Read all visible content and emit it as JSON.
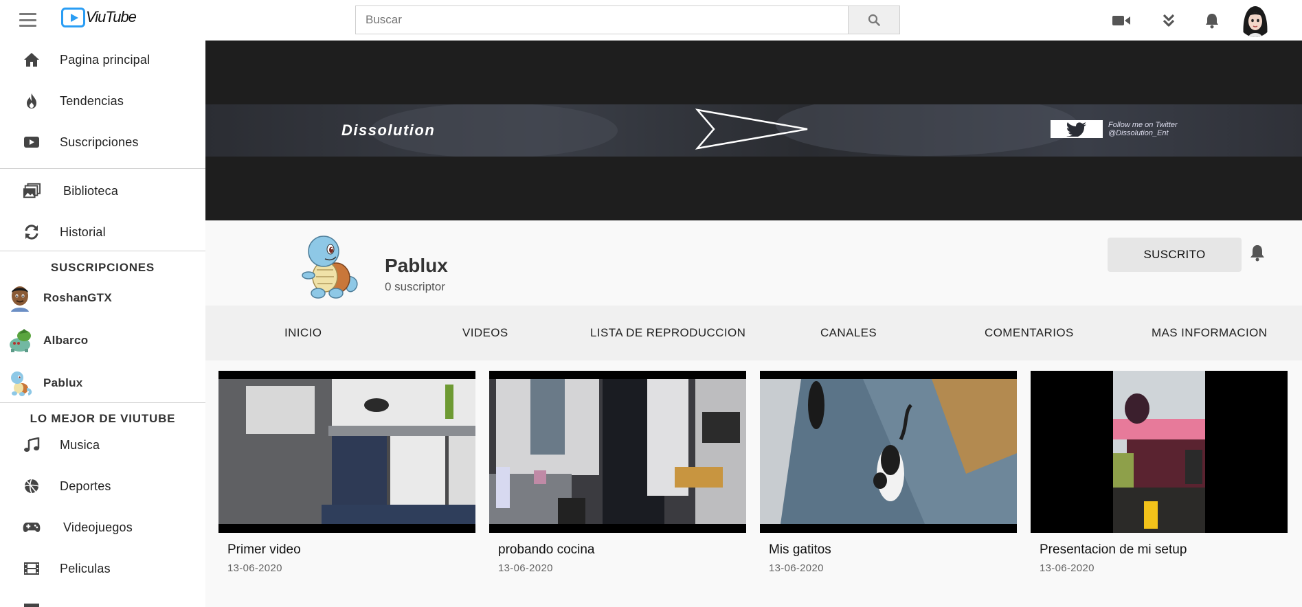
{
  "app": {
    "logo_text": "ViuTube",
    "brand_color": "#2a9df4"
  },
  "search": {
    "placeholder": "Buscar",
    "value": ""
  },
  "topbar_icons": [
    "video-camera-icon",
    "double-chevron-down-icon",
    "bell-icon",
    "user-avatar"
  ],
  "sidebar": {
    "main_items": [
      {
        "label": "Pagina principal",
        "icon": "home-icon"
      },
      {
        "label": "Tendencias",
        "icon": "fire-icon"
      },
      {
        "label": "Suscripciones",
        "icon": "subscriptions-icon"
      }
    ],
    "library_items": [
      {
        "label": "Biblioteca",
        "icon": "library-icon"
      },
      {
        "label": "Historial",
        "icon": "history-icon"
      }
    ],
    "subscriptions_heading": "SUSCRIPCIONES",
    "subscriptions": [
      {
        "label": "RoshanGTX"
      },
      {
        "label": "Albarco"
      },
      {
        "label": "Pablux"
      }
    ],
    "best_heading": "LO MEJOR DE VIUTUBE",
    "best_items": [
      {
        "label": "Musica",
        "icon": "music-note-icon"
      },
      {
        "label": "Deportes",
        "icon": "sports-ball-icon"
      },
      {
        "label": "Videojuegos",
        "icon": "gamepad-icon"
      },
      {
        "label": "Peliculas",
        "icon": "film-icon"
      }
    ]
  },
  "banner": {
    "title": "Dissolution",
    "follow_text": "Follow me on Twitter\n@Dissolution_Ent"
  },
  "channel": {
    "name": "Pablux",
    "subscribers": "0 suscriptor",
    "subscribe_button": "SUSCRITO"
  },
  "tabs": [
    "INICIO",
    "VIDEOS",
    "LISTA DE REPRODUCCION",
    "CANALES",
    "COMENTARIOS",
    "MAS INFORMACION"
  ],
  "videos": [
    {
      "title": "Primer video",
      "date": "13-06-2020"
    },
    {
      "title": "probando cocina",
      "date": "13-06-2020"
    },
    {
      "title": "Mis gatitos",
      "date": "13-06-2020"
    },
    {
      "title": "Presentacion de mi setup",
      "date": "13-06-2020"
    }
  ]
}
